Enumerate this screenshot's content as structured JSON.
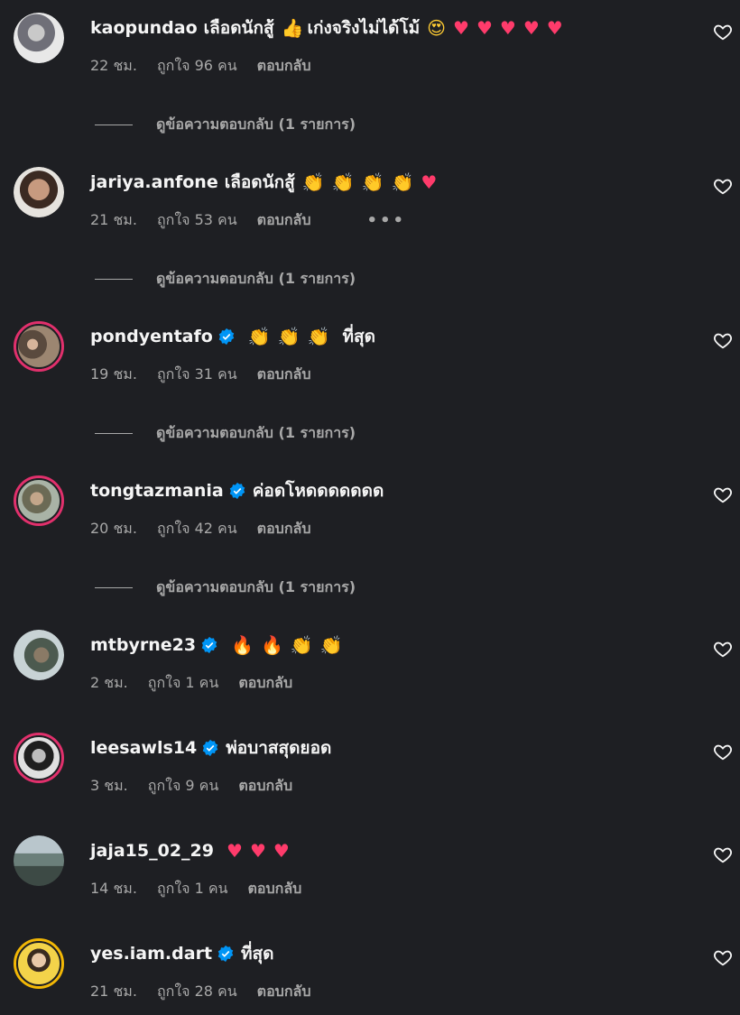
{
  "colors": {
    "background": "#1e1f23",
    "primary_text": "#f5f5f5",
    "secondary_text": "#a8a8a8",
    "verified_blue": "#0095f6",
    "heart": "#ff3b6b"
  },
  "comments": [
    {
      "username": "kaopundao",
      "verified": false,
      "text": "เลือดนักสู้",
      "emojis": [
        "thumbs-up",
        "เก่งจริงไม่ได้โม้",
        "star-eyes",
        "heart",
        "heart",
        "heart",
        "heart",
        "heart"
      ],
      "time": "22 ชม.",
      "likes": "ถูกใจ 96 คน",
      "reply": "ตอบกลับ",
      "view_replies": "ดูข้อความตอบกลับ (1 รายการ)"
    },
    {
      "username": "jariya.anfone",
      "verified": false,
      "text": "เลือดนักสู้",
      "emojis": [
        "clap",
        "clap",
        "clap",
        "clap",
        "heart"
      ],
      "time": "21 ชม.",
      "likes": "ถูกใจ 53 คน",
      "reply": "ตอบกลับ",
      "more": "•••",
      "view_replies": "ดูข้อความตอบกลับ (1 รายการ)"
    },
    {
      "username": "pondyentafo",
      "verified": true,
      "text": "",
      "emojis": [
        "clap",
        "clap",
        "clap"
      ],
      "tail": "ที่สุด",
      "time": "19 ชม.",
      "likes": "ถูกใจ 31 คน",
      "reply": "ตอบกลับ",
      "view_replies": "ดูข้อความตอบกลับ (1 รายการ)"
    },
    {
      "username": "tongtazmania",
      "verified": true,
      "text": "ค่อดโหดดดดดดด",
      "time": "20 ชม.",
      "likes": "ถูกใจ 42 คน",
      "reply": "ตอบกลับ",
      "view_replies": "ดูข้อความตอบกลับ (1 รายการ)"
    },
    {
      "username": "mtbyrne23",
      "verified": true,
      "emojis": [
        "fire",
        "fire",
        "clap",
        "clap"
      ],
      "time": "2 ชม.",
      "likes": "ถูกใจ 1 คน",
      "reply": "ตอบกลับ"
    },
    {
      "username": "leesawls14",
      "verified": true,
      "text": "พ่อบาสสุดยอด",
      "time": "3 ชม.",
      "likes": "ถูกใจ 9 คน",
      "reply": "ตอบกลับ"
    },
    {
      "username": "jaja15_02_29",
      "verified": false,
      "emojis": [
        "heart",
        "heart",
        "heart"
      ],
      "time": "14 ชม.",
      "likes": "ถูกใจ 1 คน",
      "reply": "ตอบกลับ"
    },
    {
      "username": "yes.iam.dart",
      "verified": true,
      "text": "ที่สุด",
      "time": "21 ชม.",
      "likes": "ถูกใจ 28 คน",
      "reply": "ตอบกลับ"
    }
  ]
}
